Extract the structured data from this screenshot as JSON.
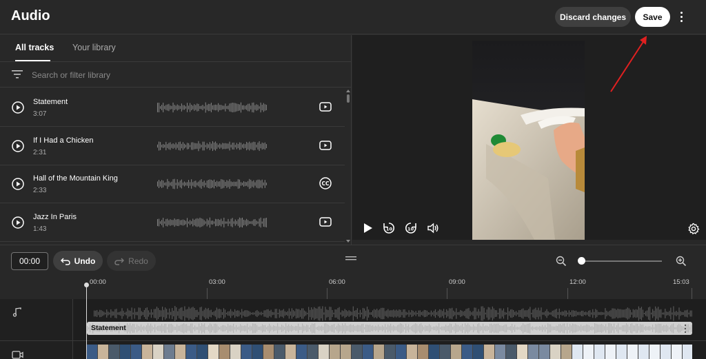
{
  "header": {
    "title": "Audio",
    "discard_label": "Discard changes",
    "save_label": "Save"
  },
  "library": {
    "tabs": [
      {
        "label": "All tracks",
        "active": true
      },
      {
        "label": "Your library",
        "active": false
      }
    ],
    "search_placeholder": "Search or filter library",
    "tracks": [
      {
        "name": "Statement",
        "duration": "3:07",
        "icon": "youtube-icon"
      },
      {
        "name": "If I Had a Chicken",
        "duration": "2:31",
        "icon": "youtube-icon"
      },
      {
        "name": "Hall of the Mountain King",
        "duration": "2:33",
        "icon": "creative-commons-icon"
      },
      {
        "name": "Jazz In Paris",
        "duration": "1:43",
        "icon": "youtube-icon"
      }
    ]
  },
  "timeline": {
    "timecode": "00:00",
    "undo_label": "Undo",
    "redo_label": "Redo",
    "zoom_level": 0,
    "ticks": [
      "00:00",
      "03:00",
      "06:00",
      "09:00",
      "12:00",
      "15:03"
    ],
    "audio_clip_label": "Statement"
  },
  "colors": {
    "background": "#282828",
    "save_bg": "#ffffff",
    "button_bg": "#3f3f3f",
    "annotation_red": "#e02020"
  }
}
